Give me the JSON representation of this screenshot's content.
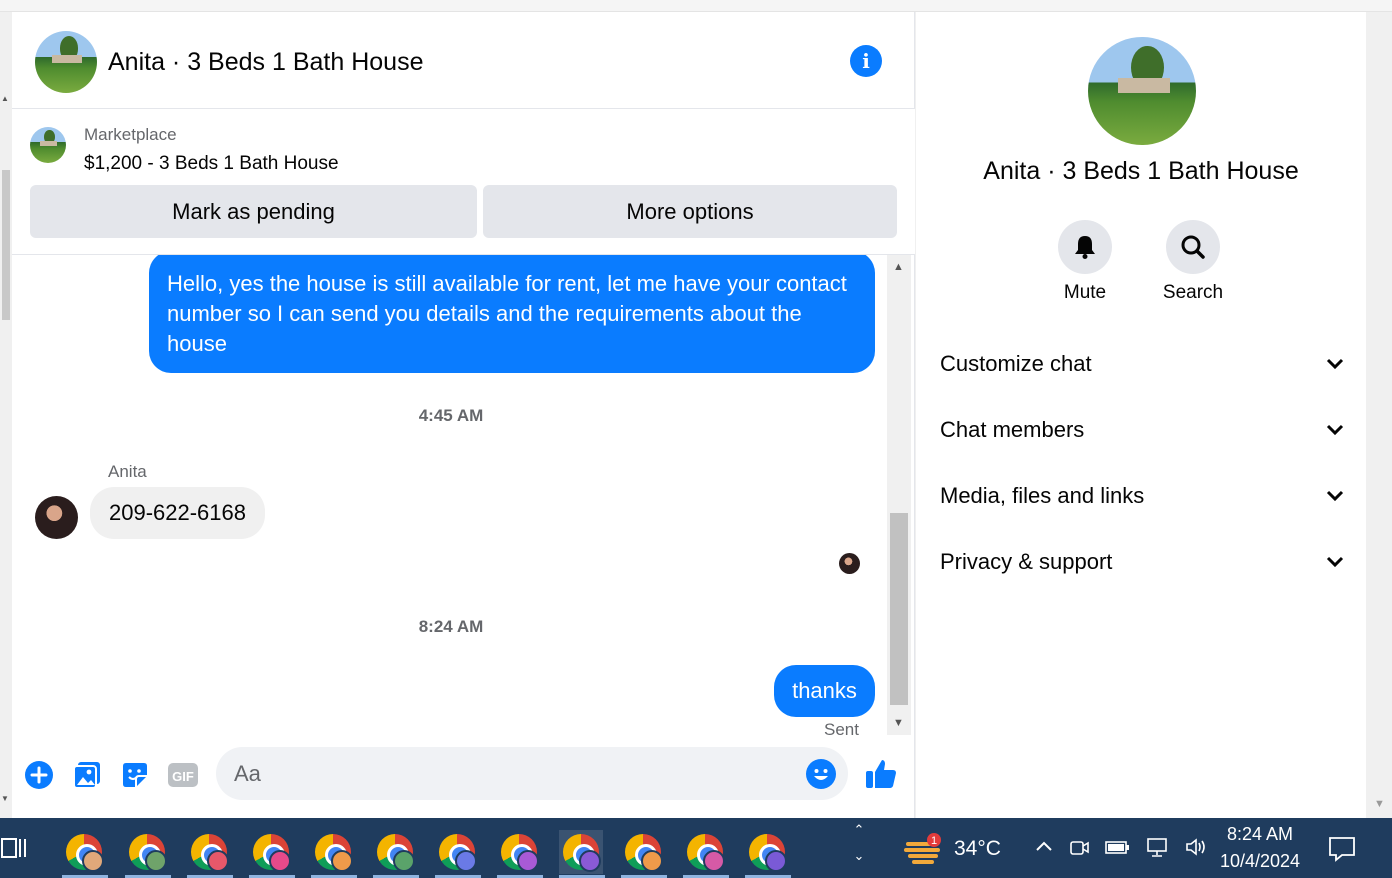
{
  "header": {
    "title": "Anita · 3 Beds 1 Bath House",
    "info_icon": "info-icon"
  },
  "listing": {
    "label": "Marketplace",
    "title": "$1,200 - 3 Beds 1 Bath House",
    "mark_pending": "Mark as pending",
    "more_options": "More options"
  },
  "messages": {
    "outgoing_1": "Hello, yes the house is still available for rent, let me have your contact number so I can send you details and the requirements about the house",
    "time_1": "4:45 AM",
    "sender": "Anita",
    "incoming_1": "209-622-6168",
    "time_2": "8:24 AM",
    "outgoing_2": "thanks",
    "status": "Sent"
  },
  "composer": {
    "placeholder": "Aa",
    "gif_label": "GIF"
  },
  "panel": {
    "name": "Anita · 3 Beds 1 Bath House",
    "mute_label": "Mute",
    "search_label": "Search",
    "sections": [
      "Customize chat",
      "Chat members",
      "Media, files and links",
      "Privacy & support"
    ]
  },
  "taskbar": {
    "weather_badge": "1",
    "temperature": "34°C",
    "time": "8:24 AM",
    "date": "10/4/2024"
  },
  "colors": {
    "accent": "#0a7cff",
    "taskbar": "#1f3c5e"
  }
}
